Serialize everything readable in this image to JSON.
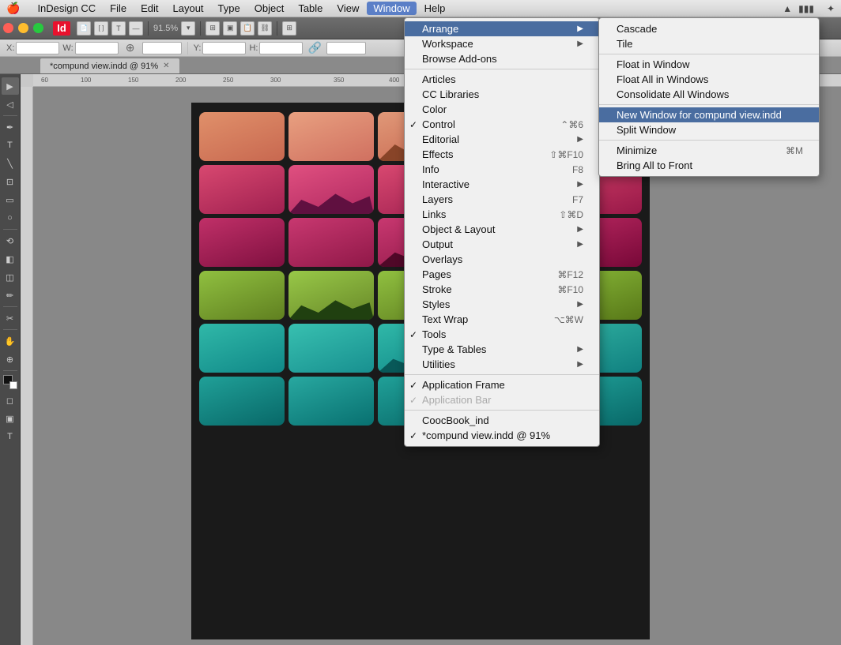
{
  "app": {
    "name": "InDesign CC",
    "logo": "Id",
    "document_tab": "*compund view.indd @ 91%",
    "zoom": "91.5%"
  },
  "mac_menu": {
    "apple": "🍎",
    "items": [
      "InDesign CC",
      "File",
      "Edit",
      "Layout",
      "Type",
      "Object",
      "Table",
      "View",
      "Window",
      "Help"
    ]
  },
  "window_menu": {
    "title": "Window",
    "items": [
      {
        "label": "Arrange",
        "has_submenu": true,
        "highlighted": true
      },
      {
        "label": "Workspace",
        "has_submenu": true
      },
      {
        "label": "Browse Add-ons",
        "has_submenu": false
      },
      {
        "label": "---"
      },
      {
        "label": "Articles"
      },
      {
        "label": "CC Libraries"
      },
      {
        "label": "Color"
      },
      {
        "label": "Control",
        "checked": true,
        "shortcut": "⌃⌘6"
      },
      {
        "label": "Editorial",
        "has_submenu": true
      },
      {
        "label": "Effects",
        "shortcut": "⇧⌘F10"
      },
      {
        "label": "Info",
        "shortcut": "F8"
      },
      {
        "label": "Interactive",
        "has_submenu": true
      },
      {
        "label": "Layers",
        "shortcut": "F7"
      },
      {
        "label": "Links",
        "shortcut": "⇧⌘D"
      },
      {
        "label": "Object & Layout",
        "has_submenu": true
      },
      {
        "label": "Output",
        "has_submenu": true
      },
      {
        "label": "Overlays"
      },
      {
        "label": "Pages",
        "shortcut": "⌘F12"
      },
      {
        "label": "Stroke",
        "shortcut": "⌘F10"
      },
      {
        "label": "Styles",
        "has_submenu": true
      },
      {
        "label": "Text Wrap",
        "shortcut": "⌥⌘W"
      },
      {
        "label": "Tools",
        "checked": true
      },
      {
        "label": "Type & Tables",
        "has_submenu": true
      },
      {
        "label": "Utilities",
        "has_submenu": true
      },
      {
        "label": "---"
      },
      {
        "label": "Application Frame",
        "checked": true
      },
      {
        "label": "Application Bar",
        "checked": true,
        "disabled": true
      },
      {
        "label": "---"
      },
      {
        "label": "CoocBook_ind"
      },
      {
        "label": "*compund view.indd @ 91%",
        "checked": true
      }
    ]
  },
  "arrange_submenu": {
    "items": [
      {
        "label": "Cascade"
      },
      {
        "label": "Tile"
      },
      {
        "label": "---"
      },
      {
        "label": "Float in Window"
      },
      {
        "label": "Float All in Windows"
      },
      {
        "label": "Consolidate All Windows"
      },
      {
        "label": "---"
      },
      {
        "label": "New Window for compund view.indd",
        "highlighted": true
      },
      {
        "label": "Split Window"
      },
      {
        "label": "---"
      },
      {
        "label": "Minimize",
        "shortcut": "⌘M"
      },
      {
        "label": "Bring All to Front"
      }
    ]
  },
  "toolbar": {
    "x_label": "X:",
    "x_value": "",
    "y_label": "Y:",
    "y_value": "",
    "w_label": "W:",
    "w_value": "",
    "h_label": "H:",
    "h_value": ""
  },
  "status_bar": {
    "text": ""
  }
}
